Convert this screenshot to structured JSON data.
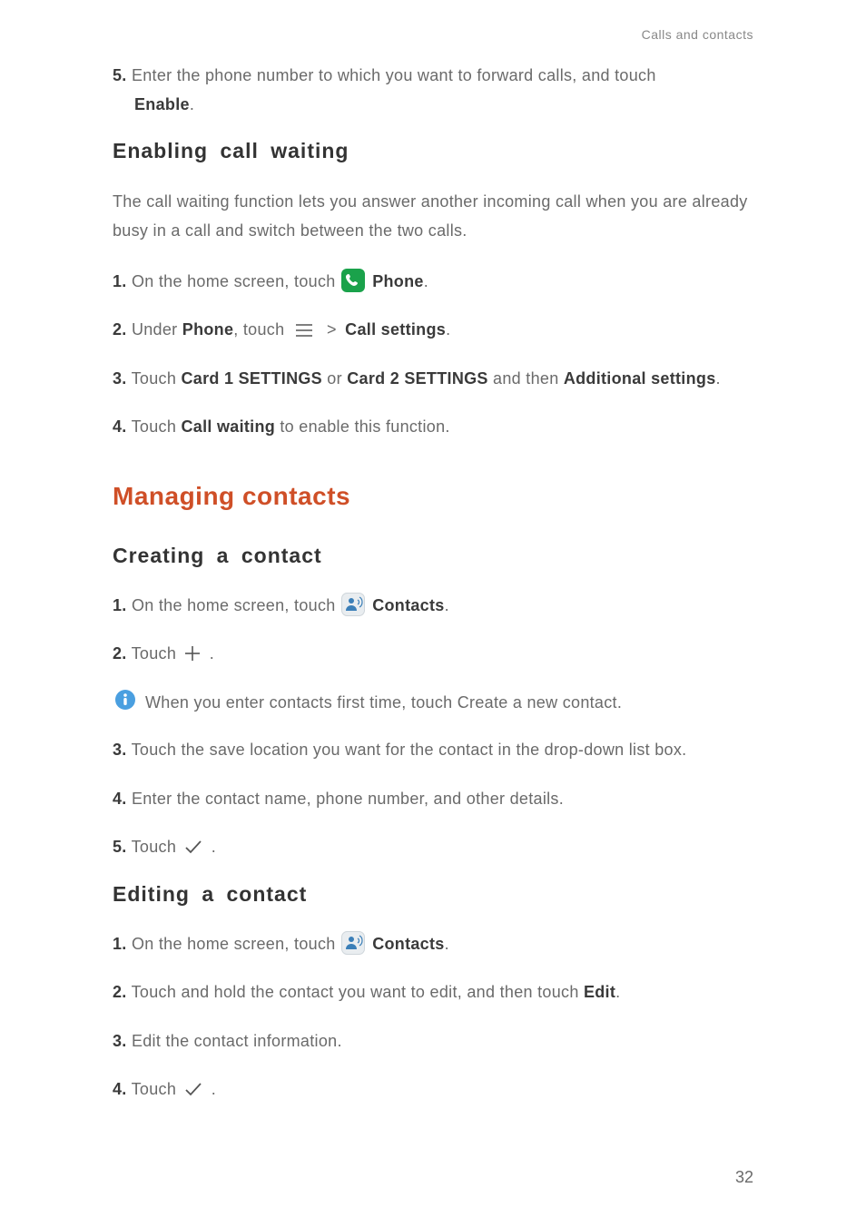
{
  "running_header": "Calls and contacts",
  "page_number": "32",
  "step5_top": {
    "num": "5.",
    "pre": "Enter the phone number to which you want to forward calls, and touch ",
    "bold": "Enable",
    "post": "."
  },
  "h2_enable": "Enabling  call  waiting",
  "para_enable": "The call waiting function lets you answer another incoming call when you are already busy in a call and switch between the two calls.",
  "enable_s1": {
    "num": "1.",
    "pre": "On the home screen, touch ",
    "bold": "Phone",
    "post": "."
  },
  "enable_s2": {
    "num": "2.",
    "pre": "Under ",
    "bold1": "Phone",
    "mid": ", touch ",
    "bold2": "Call settings",
    "post": "."
  },
  "enable_s3": {
    "num": "3.",
    "pre": "Touch ",
    "b1": "Card 1 SETTINGS",
    "or": " or ",
    "b2": "Card 2 SETTINGS",
    "mid": " and then ",
    "b3": "Additional settings",
    "post": "."
  },
  "enable_s4": {
    "num": "4.",
    "pre": "Touch ",
    "b1": "Call waiting",
    "post": " to enable this function."
  },
  "h1_manage": "Managing contacts",
  "h2_create": "Creating  a  contact",
  "create_s1": {
    "num": "1.",
    "pre": "On the home screen, touch ",
    "bold": "Contacts",
    "post": "."
  },
  "create_s2": {
    "num": "2.",
    "pre": "Touch ",
    "post": "."
  },
  "info_create": {
    "pre": "When you enter contacts first time, touch ",
    "bold": "Create a new contact",
    "post": "."
  },
  "create_s3": {
    "num": "3.",
    "text": "Touch the save location you want for the contact in the drop-down list box."
  },
  "create_s4": {
    "num": "4.",
    "text": "Enter the contact name, phone number, and other details."
  },
  "create_s5": {
    "num": "5.",
    "pre": "Touch ",
    "post": "."
  },
  "h2_edit": "Editing  a  contact",
  "edit_s1": {
    "num": "1.",
    "pre": "On the home screen, touch ",
    "bold": "Contacts",
    "post": "."
  },
  "edit_s2": {
    "num": "2.",
    "pre": "Touch and hold the contact you want to edit, and then touch ",
    "bold": "Edit",
    "post": "."
  },
  "edit_s3": {
    "num": "3.",
    "text": "Edit the contact information."
  },
  "edit_s4": {
    "num": "4.",
    "pre": "Touch ",
    "post": "."
  }
}
